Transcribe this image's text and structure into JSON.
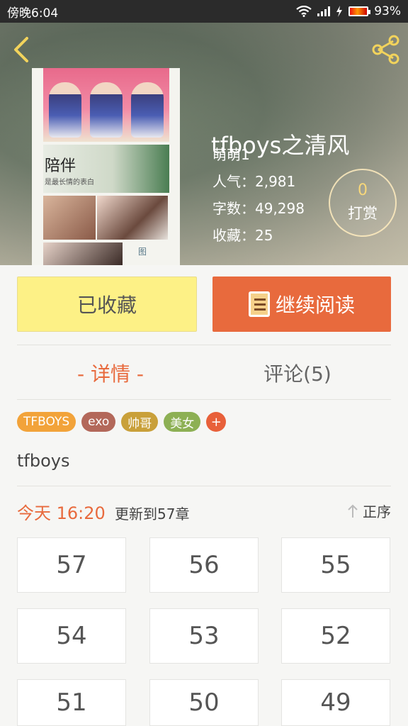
{
  "status_bar": {
    "time": "傍晚6:04",
    "battery": "93%"
  },
  "book": {
    "title": "tfboys之清风",
    "author": "萌萌1",
    "popularity": "人气：2,981",
    "word_count": "字数：49,298",
    "favorites": "收藏：25",
    "cover_caption": "陪伴",
    "cover_subcaption": "是最长情的表白",
    "cover_logo": "图"
  },
  "reward": {
    "count": "0",
    "label": "打赏"
  },
  "actions": {
    "favorited_label": "已收藏",
    "continue_label": "继续阅读"
  },
  "tabs": {
    "detail": "- 详情 -",
    "comments": "评论(5)"
  },
  "tags": [
    {
      "label": "TFBOYS",
      "color": "#f2a33a"
    },
    {
      "label": "exo",
      "color": "#b3685a"
    },
    {
      "label": "帅哥",
      "color": "#c9a03a"
    },
    {
      "label": "美女",
      "color": "#8db054"
    }
  ],
  "tag_add": "+",
  "description": "tfboys",
  "update": {
    "time": "今天 16:20",
    "text": "更新到57章",
    "sort_label": "正序"
  },
  "chapters": [
    "57",
    "56",
    "55",
    "54",
    "53",
    "52",
    "51",
    "50",
    "49"
  ],
  "colors": {
    "accent": "#e86a3d",
    "favorite_bg": "#fdf186"
  }
}
